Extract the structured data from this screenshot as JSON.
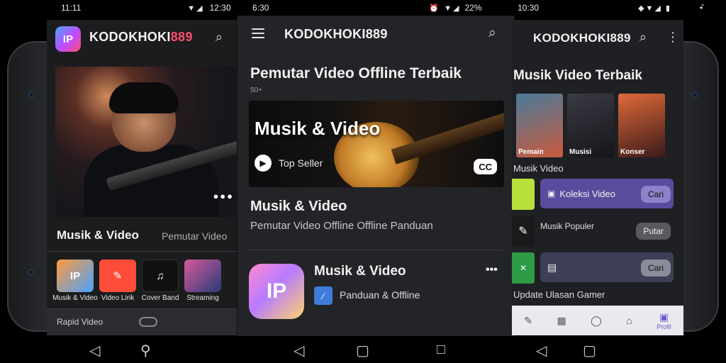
{
  "left_phone": {
    "status_time": "11:11",
    "status_right": "12:30",
    "brand": "KODOKHOKI",
    "brand_hl": "889",
    "logo_text": "IP",
    "row_title": "Musik & Video",
    "row_sub": "Pemutar Video",
    "tiles": [
      {
        "label": "IP",
        "caption": "Musik & Video",
        "color": "#ff7a3c"
      },
      {
        "label": "✎",
        "caption": "Video Lirik",
        "color": "#ff4d3a"
      },
      {
        "label": "♫",
        "caption": "Cover Band",
        "color": "#101010"
      },
      {
        "label": "",
        "caption": "Streaming",
        "color": "#d65a9a"
      }
    ],
    "bottom_label": "Rapid Video",
    "carousel_dots": "●●●"
  },
  "center_phone": {
    "status_time": "6:30",
    "status_battery": "22%",
    "brand": "KODOKHOKI889",
    "headline": "Pemutar Video Offline Terbaik",
    "headline_sub": "50+",
    "hero_title": "Musik & Video",
    "hero_author": "Top Seller",
    "hero_badge": "CC",
    "section_title": "Musik & Video",
    "section_sub": "Pemutar Video Offline Offline Panduan",
    "app_title": "Musik & Video",
    "app_icon_text": "IP",
    "app_tag": "Panduan & Offline",
    "more_icon": "•••"
  },
  "right_phone": {
    "status_time": "10:30",
    "brand": "KODOKHOKI889",
    "headline": "Musik Video Terbaik",
    "thumbs": [
      {
        "caption": "Pemain",
        "color": "#c95a3d"
      },
      {
        "caption": "Musisi",
        "color": "#2c2c35"
      },
      {
        "caption": "Konser",
        "color": "#d9643a"
      }
    ],
    "section_label": "Musik Video",
    "rows": [
      {
        "label": "Koleksi Video",
        "button": "Cari",
        "sq_color": "#b6e03a",
        "bg": "#5b4b9c"
      },
      {
        "label": "Musik Populer",
        "button": "Putar",
        "sq_color": "#2a2a2a",
        "bg": "transparent"
      },
      {
        "label": "",
        "button": "Cari",
        "sq_color": "#2e9b46",
        "bg": "#3d3f58"
      }
    ],
    "footer_label": "Update Ulasan Gamer",
    "nav_active": "Profil"
  }
}
